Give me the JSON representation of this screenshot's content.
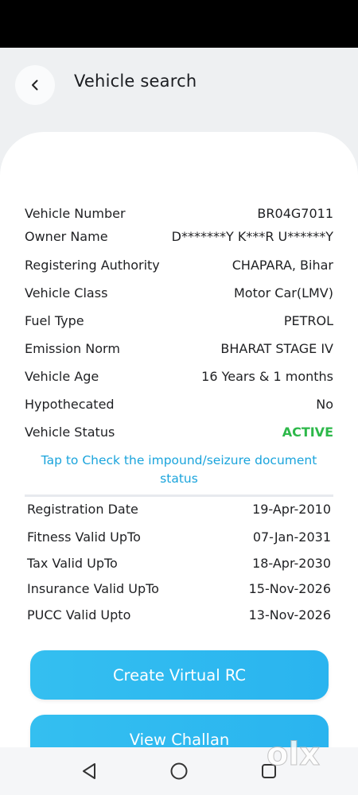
{
  "header": {
    "title": "Vehicle search",
    "back_icon": "chevron-left-icon"
  },
  "vehicle_details": [
    {
      "label": "Vehicle Number",
      "value": "BR04G7011"
    },
    {
      "label": "Owner Name",
      "value": "D*******Y K***R U******Y"
    },
    {
      "label": "Registering Authority",
      "value": "CHAPARA, Bihar"
    },
    {
      "label": "Vehicle Class",
      "value": "Motor Car(LMV)"
    },
    {
      "label": "Fuel Type",
      "value": "PETROL"
    },
    {
      "label": "Emission Norm",
      "value": "BHARAT STAGE IV"
    },
    {
      "label": "Vehicle Age",
      "value": "16 Years  & 1 months"
    },
    {
      "label": "Hypothecated",
      "value": "No"
    },
    {
      "label": "Vehicle Status",
      "value": "ACTIVE"
    }
  ],
  "impound_link": "Tap to Check the impound/seizure document status",
  "validity": [
    {
      "label": "Registration Date",
      "value": "19-Apr-2010"
    },
    {
      "label": "Fitness Valid UpTo",
      "value": "07-Jan-2031"
    },
    {
      "label": "Tax Valid UpTo",
      "value": "18-Apr-2030"
    },
    {
      "label": "Insurance Valid UpTo",
      "value": "15-Nov-2026"
    },
    {
      "label": "PUCC Valid Upto",
      "value": "13-Nov-2026"
    }
  ],
  "buttons": {
    "create_virtual_rc": "Create Virtual RC",
    "view_challan": "View Challan"
  },
  "colors": {
    "accent": "#2ab4ef",
    "status_active": "#2db84a",
    "link": "#1aa4dc"
  },
  "watermark": "olx"
}
